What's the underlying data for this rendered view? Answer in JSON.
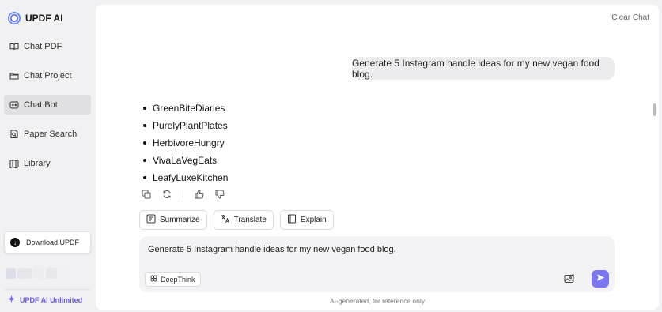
{
  "brand": {
    "name": "UPDF AI",
    "icon": "updf-logo-icon"
  },
  "sidebar": {
    "items": [
      {
        "label": "Chat PDF",
        "icon": "book-open-icon",
        "active": false
      },
      {
        "label": "Chat Project",
        "icon": "folder-icon",
        "active": false
      },
      {
        "label": "Chat Bot",
        "icon": "chat-bot-icon",
        "active": true
      },
      {
        "label": "Paper Search",
        "icon": "document-search-icon",
        "active": false
      },
      {
        "label": "Library",
        "icon": "library-icon",
        "active": false
      }
    ],
    "download_label": "Download UPDF",
    "unlimited_label": "UPDF AI Unlimited"
  },
  "header": {
    "clear_chat_label": "Clear Chat"
  },
  "conversation": {
    "user_message": "Generate 5 Instagram handle ideas for my new vegan food blog.",
    "answer_items": [
      "GreenBiteDiaries",
      "PurelyPlantPlates",
      "HerbivoreHungry",
      "VivaLaVegEats",
      "LeafyLuxeKitchen"
    ]
  },
  "message_actions": [
    "copy-icon",
    "regenerate-icon",
    "thumbs-up-icon",
    "thumbs-down-icon"
  ],
  "quick_actions": {
    "summarize": "Summarize",
    "translate": "Translate",
    "explain": "Explain"
  },
  "composer": {
    "value": "Generate 5 Instagram handle ideas for my new vegan food blog.",
    "deepthink_label": "DeepThink"
  },
  "footer": {
    "disclaimer": "AI-generated, for reference only"
  },
  "colors": {
    "accent": "#7b77f0",
    "unlimited": "#6a5de0",
    "active_nav": "#e0e0e3"
  }
}
